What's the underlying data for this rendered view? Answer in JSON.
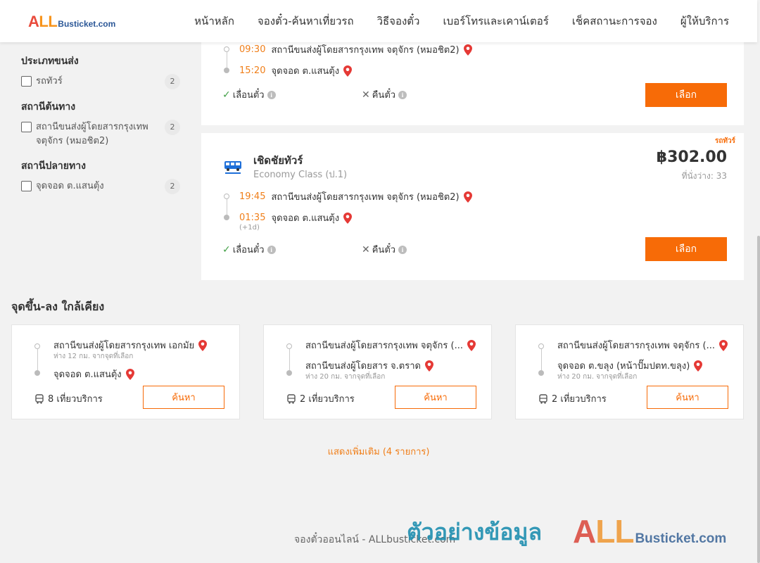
{
  "header": {
    "logo_all": "ALL",
    "logo_rest": "Busticket.com",
    "nav": [
      "หน้าหลัก",
      "จองตั๋ว-ค้นหาเที่ยวรถ",
      "วิธีจองตั๋ว",
      "เบอร์โทรและเคาน์เตอร์",
      "เช็คสถานะการจอง",
      "ผู้ให้บริการ"
    ]
  },
  "filters": {
    "groups": [
      {
        "title": "ประเภทขนส่ง",
        "options": [
          {
            "label": "รถทัวร์",
            "count": "2"
          }
        ]
      },
      {
        "title": "สถานีต้นทาง",
        "options": [
          {
            "label": "สถานีขนส่งผู้โดยสารกรุงเทพ จตุจักร (หมอชิต2)",
            "count": "2"
          }
        ]
      },
      {
        "title": "สถานีปลายทาง",
        "options": [
          {
            "label": "จุดจอด ต.แสนตุ้ง",
            "count": "2"
          }
        ]
      }
    ]
  },
  "trips": [
    {
      "depart_time": "09:30",
      "depart_station": "สถานีขนส่งผู้โดยสารกรุงเทพ จตุจักร (หมอชิต2)",
      "arrive_time": "15:20",
      "arrive_station": "จุดจอด ต.แสนตุ้ง",
      "feature_reschedule": "เลื่อนตั๋ว",
      "feature_refund": "คืนตั๋ว",
      "select_label": "เลือก"
    },
    {
      "badge": "รถทัวร์",
      "operator": "เชิดชัยทัวร์",
      "bus_class": "Economy Class (ป.1)",
      "price": "฿302.00",
      "seats": "ที่นั่งว่าง: 33",
      "depart_time": "19:45",
      "depart_station": "สถานีขนส่งผู้โดยสารกรุงเทพ จตุจักร (หมอชิต2)",
      "arrive_time": "01:35",
      "arrive_station": "จุดจอด ต.แสนตุ้ง",
      "next_day": "(+1d)",
      "feature_reschedule": "เลื่อนตั๋ว",
      "feature_refund": "คืนตั๋ว",
      "select_label": "เลือก"
    }
  ],
  "nearby": {
    "title": "จุดขึ้น-ลง ใกล้เคียง",
    "cards": [
      {
        "from": "สถานีขนส่งผู้โดยสารกรุงเทพ เอกมัย",
        "from_dist": "ห่าง 12 กม. จากจุดที่เลือก",
        "to": "จุดจอด ต.แสนตุ้ง",
        "to_dist": "",
        "trips": "8 เที่ยวบริการ",
        "search_label": "ค้นหา"
      },
      {
        "from": "สถานีขนส่งผู้โดยสารกรุงเทพ จตุจักร (...",
        "from_dist": "",
        "to": "สถานีขนส่งผู้โดยสาร จ.ตราด",
        "to_dist": "ห่าง 20 กม. จากจุดที่เลือก",
        "trips": "2 เที่ยวบริการ",
        "search_label": "ค้นหา"
      },
      {
        "from": "สถานีขนส่งผู้โดยสารกรุงเทพ จตุจักร (...",
        "from_dist": "",
        "to": "จุดจอด ต.ขลุง (หน้าปั๊มปตท.ขลุง)",
        "to_dist": "ห่าง 20 กม. จากจุดที่เลือก",
        "trips": "2 เที่ยวบริการ",
        "search_label": "ค้นหา"
      }
    ],
    "show_more": "แสดงเพิ่มเติม (4 รายการ)"
  },
  "footer": {
    "text": "จองตั๋วออนไลน์ - ALLbusticket.com"
  },
  "watermark": {
    "text": "ตัวอย่างข้อมูล",
    "logo_all": "ALL",
    "logo_rest": "Busticket.com"
  },
  "colors": {
    "accent": "#f76b07",
    "time": "#f07f1a",
    "pin": "#e53935",
    "check": "#43a047"
  }
}
